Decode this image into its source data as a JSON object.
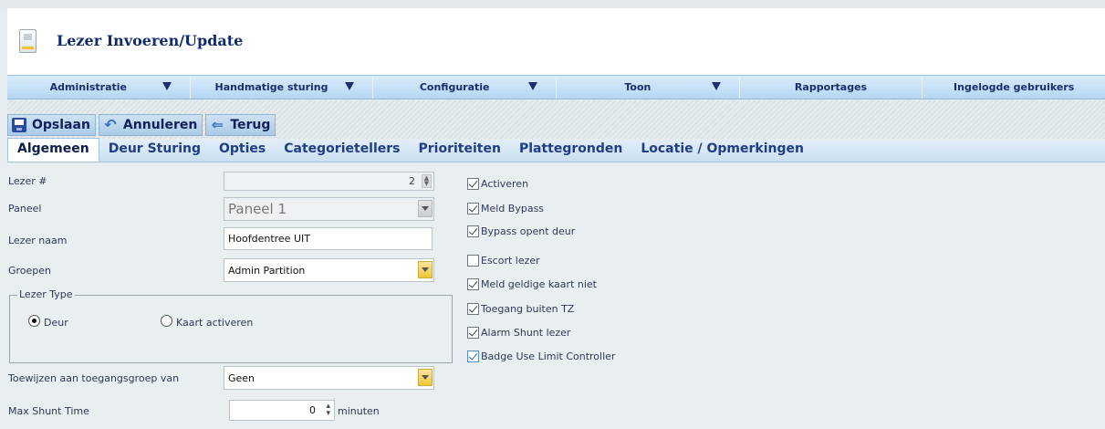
{
  "header": {
    "title": "Lezer Invoeren/Update",
    "icon": "document-icon"
  },
  "menu": [
    {
      "label": "Administratie",
      "has_arrow": true
    },
    {
      "label": "Handmatige sturing",
      "has_arrow": true
    },
    {
      "label": "Configuratie",
      "has_arrow": true
    },
    {
      "label": "Toon",
      "has_arrow": true
    },
    {
      "label": "Rapportages",
      "has_arrow": false
    },
    {
      "label": "Ingelogde gebruikers",
      "has_arrow": false
    }
  ],
  "toolbar": {
    "save": "Opslaan",
    "cancel": "Annuleren",
    "back": "Terug"
  },
  "tabs": [
    "Algemeen",
    "Deur Sturing",
    "Opties",
    "Categorietellers",
    "Prioriteiten",
    "Plattegronden",
    "Locatie / Opmerkingen"
  ],
  "active_tab": "Algemeen",
  "form": {
    "lezer_nr": {
      "label": "Lezer #",
      "value": "2"
    },
    "paneel": {
      "label": "Paneel",
      "value": "Paneel 1"
    },
    "lezer_naam": {
      "label": "Lezer naam",
      "value": "Hoofdentree UIT"
    },
    "groepen": {
      "label": "Groepen",
      "value": "Admin Partition"
    },
    "lezer_type": {
      "legend": "Lezer Type",
      "options": [
        "Deur",
        "Kaart activeren"
      ],
      "selected": "Deur"
    },
    "toewijzen": {
      "label": "Toewijzen aan toegangsgroep van",
      "value": "Geen"
    },
    "max_shunt": {
      "label": "Max Shunt Time",
      "value": "0",
      "unit": "minuten"
    }
  },
  "checkboxes": [
    {
      "label": "Activeren",
      "checked": true
    },
    {
      "label": "Meld Bypass",
      "checked": true
    },
    {
      "label": "Bypass opent deur",
      "checked": true
    },
    {
      "label": "Escort lezer",
      "checked": false
    },
    {
      "label": "Meld geldige kaart niet",
      "checked": true
    },
    {
      "label": "Toegang buiten TZ",
      "checked": true
    },
    {
      "label": "Alarm Shunt lezer",
      "checked": true
    },
    {
      "label": "Badge Use Limit Controller",
      "checked": true
    }
  ],
  "colors": {
    "accent": "#1a2e6c",
    "menu_bg": "#b4d6f3",
    "dropdown_btn": "#f0c63f"
  }
}
